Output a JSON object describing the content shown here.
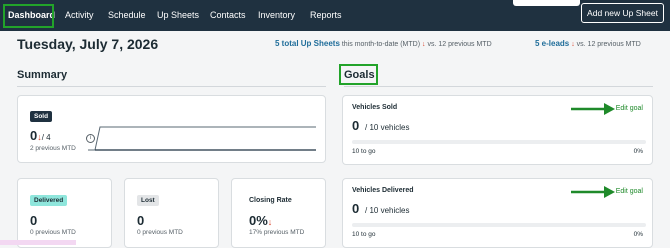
{
  "nav": {
    "items": [
      "Dashboard",
      "Activity",
      "Schedule",
      "Up Sheets",
      "Contacts",
      "Inventory",
      "Reports"
    ],
    "add_button": "Add new Up Sheet",
    "highlight_color": "#22a32a"
  },
  "header": {
    "date": "Tuesday, July 7, 2026",
    "upsheets": {
      "count": "5 total Up Sheets",
      "suffix": "this month-to-date (MTD)",
      "compare": "vs. 12 previous MTD"
    },
    "eleads": {
      "count": "5 e-leads",
      "compare": "vs. 12 previous MTD"
    }
  },
  "summary": {
    "title": "Summary",
    "sold": {
      "badge": "Sold",
      "value": "0",
      "goal": "/ 4",
      "previous": "2 previous MTD",
      "info_icon": "info-icon"
    },
    "delivered": {
      "badge": "Delivered",
      "value": "0",
      "previous": "0 previous MTD"
    },
    "lost": {
      "badge": "Lost",
      "value": "0",
      "previous": "0 previous MTD"
    },
    "closing_rate": {
      "label": "Closing Rate",
      "value": "0%",
      "previous": "17% previous MTD"
    }
  },
  "goals": {
    "title": "Goals",
    "items": [
      {
        "title": "Vehicles Sold",
        "value": "0",
        "target": "/ 10 vehicles",
        "to_go": "10 to go",
        "percent": "0%",
        "edit": "Edit goal",
        "progress": 0
      },
      {
        "title": "Vehicles Delivered",
        "value": "0",
        "target": "/ 10 vehicles",
        "to_go": "10 to go",
        "percent": "0%",
        "edit": "Edit goal",
        "progress": 0
      }
    ]
  },
  "colors": {
    "nav_bg": "#1f3140",
    "accent_blue": "#1f6d9a",
    "down_red": "#d9442b",
    "annotation_green": "#22a32a"
  }
}
